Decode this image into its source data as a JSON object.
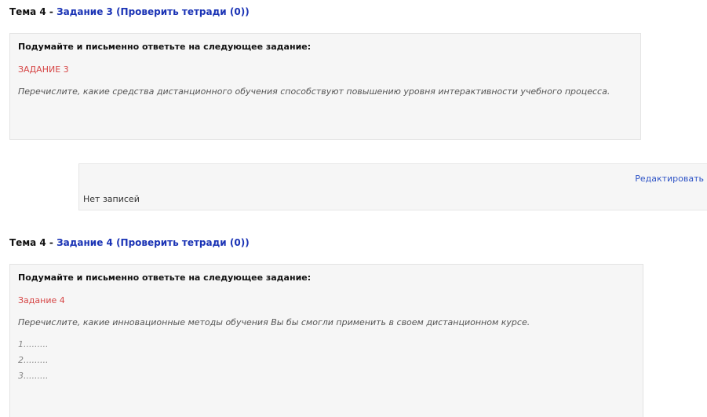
{
  "sections": [
    {
      "title_prefix": "Тема 4 - ",
      "task_link": "Задание 3",
      "check_link": "(Проверить тетради (0))",
      "prompt": "Подумайте и письменно ответьте на следующее задание:",
      "task_label": "ЗАДАНИЕ 3",
      "task_text": "Перечислите, какие средства дистанционного обучения способствуют повышению уровня интерактивности учебного процесса.",
      "edit_link": "Редактировать",
      "empty_text": "Нет записей"
    },
    {
      "title_prefix": "Тема 4 - ",
      "task_link": "Задание 4",
      "check_link": "(Проверить тетради (0))",
      "prompt": "Подумайте и письменно ответьте на следующее задание:",
      "task_label": "Задание 4",
      "task_text": "Перечислите, какие инновационные методы обучения Вы бы смогли применить в своем дистанционном курсе.",
      "list_items": [
        "1.........",
        "2.........",
        "3........."
      ]
    }
  ]
}
